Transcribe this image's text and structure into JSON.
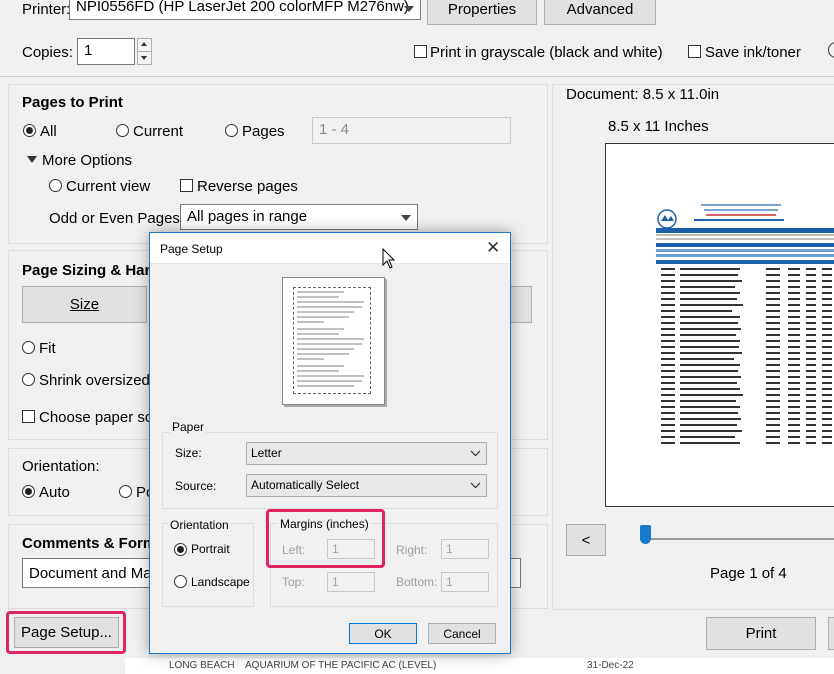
{
  "printer": {
    "label": "Printer:",
    "value": "NPI0556FD (HP LaserJet 200 colorMFP M276nw)",
    "properties_label": "Properties",
    "advanced_label": "Advanced"
  },
  "copies": {
    "label": "Copies:",
    "value": "1",
    "grayscale_label": "Print in grayscale (black and white)",
    "save_ink_label": "Save ink/toner"
  },
  "pages_to_print": {
    "title": "Pages to Print",
    "all_label": "All",
    "current_label": "Current",
    "pages_label": "Pages",
    "pages_value": "1 - 4",
    "more_options_label": "More Options",
    "current_view_label": "Current view",
    "reverse_pages_label": "Reverse pages",
    "odd_even_label": "Odd or Even Pages:",
    "odd_even_value": "All pages in range"
  },
  "sizing": {
    "title": "Page Sizing & Han",
    "size_tab": "Size",
    "fit_label": "Fit",
    "shrink_label": "Shrink oversized",
    "choose_paper_label": "Choose paper so"
  },
  "orientation": {
    "title": "Orientation:",
    "auto_label": "Auto",
    "portrait_partial": "Po"
  },
  "comments": {
    "title": "Comments & Form",
    "value": "Document and Ma"
  },
  "page_setup_button": "Page Setup...",
  "preview": {
    "document_size": "Document: 8.5 x 11.0in",
    "paper_label": "8.5 x 11 Inches",
    "page_label": "Page 1 of 4",
    "prev_label": "<"
  },
  "print_button": "Print",
  "dialog": {
    "title": "Page Setup",
    "paper_group": "Paper",
    "size_label": "Size:",
    "size_value": "Letter",
    "source_label": "Source:",
    "source_value": "Automatically Select",
    "orientation_group": "Orientation",
    "portrait_label": "Portrait",
    "landscape_label": "Landscape",
    "margins_group": "Margins (inches)",
    "left_label": "Left:",
    "left_value": "1",
    "right_label": "Right:",
    "right_value": "1",
    "top_label": "Top:",
    "top_value": "1",
    "bottom_label": "Bottom:",
    "bottom_value": "1",
    "ok_label": "OK",
    "cancel_label": "Cancel"
  },
  "bg_fragments": {
    "left_text": "LONG BEACH",
    "mid_text": "AQUARIUM OF THE PACIFIC AC (LEVEL)",
    "date_text": "31-Dec-22"
  },
  "colors": {
    "highlight": "#e0245e",
    "dialog_border": "#1979ca",
    "preview_header": "#1f5fa8"
  }
}
